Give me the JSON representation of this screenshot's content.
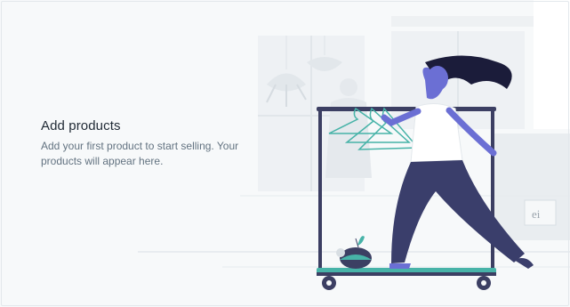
{
  "empty_state": {
    "title": "Add products",
    "description": "Add your first product to start selling. Your products will appear here."
  },
  "illustration": {
    "icon": "woman-pushing-clothing-rack-illustration",
    "colors": {
      "background": "#f7f9fa",
      "rack": "#3c3f63",
      "accent": "#47b3a8",
      "figure": "#6b6fd4",
      "pants": "#3a3e6b",
      "hair": "#1b1c3a"
    }
  }
}
